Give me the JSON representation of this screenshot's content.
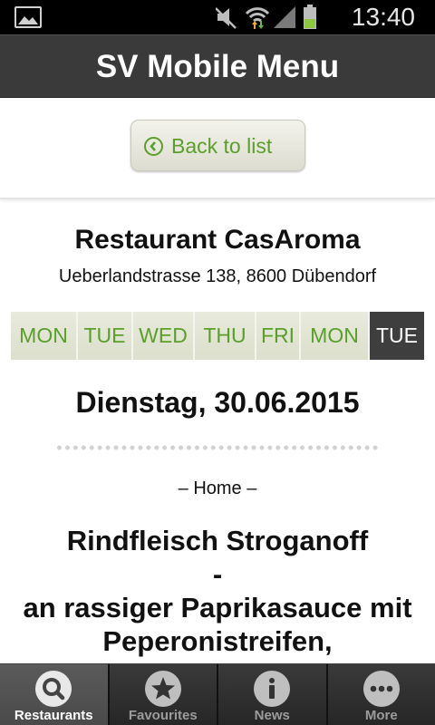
{
  "status_bar": {
    "time": "13:40",
    "icons": [
      "gallery-icon",
      "mute-icon",
      "wifi-icon",
      "signal-icon",
      "battery-icon"
    ]
  },
  "header": {
    "title": "SV Mobile Menu"
  },
  "back_button": {
    "label": "Back to list",
    "icon": "chevron-left-circle-icon"
  },
  "restaurant": {
    "name": "Restaurant CasAroma",
    "address": "Ueberlandstrasse 138, 8600 Dübendorf"
  },
  "days": [
    {
      "label": "MON",
      "active": false
    },
    {
      "label": "TUE",
      "active": false
    },
    {
      "label": "WED",
      "active": false
    },
    {
      "label": "THU",
      "active": false
    },
    {
      "label": "FRI",
      "active": false
    },
    {
      "label": "MON",
      "active": false
    },
    {
      "label": "TUE",
      "active": true
    }
  ],
  "menu": {
    "date": "Dienstag, 30.06.2015",
    "category": "– Home –",
    "dish_lines": [
      "Rindfleisch Stroganoff",
      "-",
      "an rassiger Paprikasauce mit",
      "Peperonistreifen,"
    ]
  },
  "tabs": [
    {
      "label": "Restaurants",
      "icon": "search-icon",
      "active": true
    },
    {
      "label": "Favourites",
      "icon": "star-icon",
      "active": false
    },
    {
      "label": "News",
      "icon": "info-icon",
      "active": false
    },
    {
      "label": "More",
      "icon": "more-icon",
      "active": false
    }
  ],
  "colors": {
    "accent": "#5a9f2a",
    "header": "#3a3a3a",
    "active_day": "#3e3e3e"
  }
}
